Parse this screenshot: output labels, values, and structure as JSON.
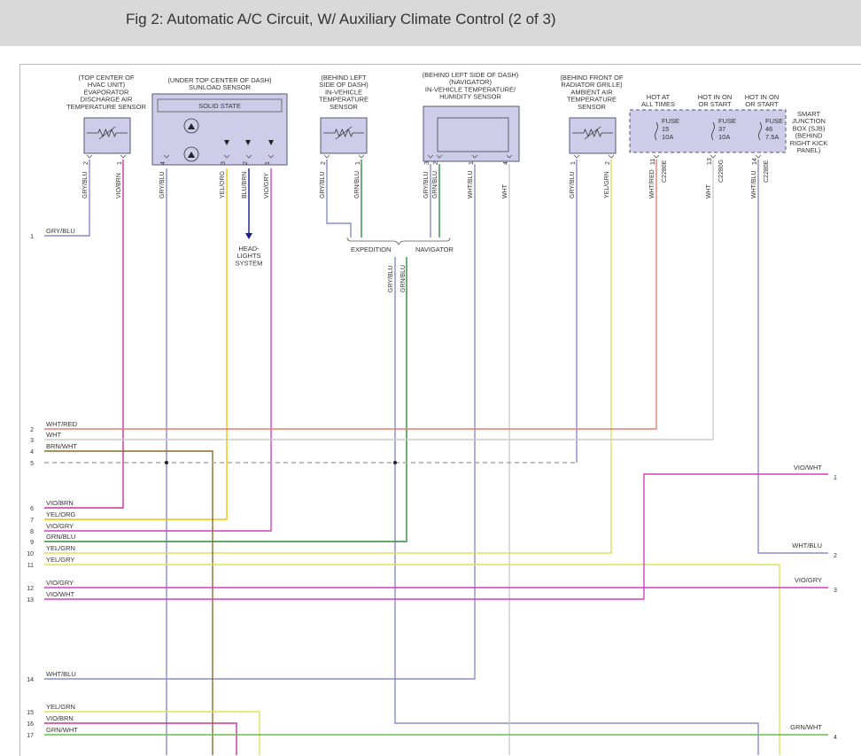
{
  "header": {
    "title": "Fig 2: Automatic A/C Circuit, W/ Auxiliary Climate Control (2 of 3)"
  },
  "colors": {
    "gry_blu": "#8b8bd0",
    "vio_brn": "#cc3399",
    "yel_org": "#f2c200",
    "blu_brn": "#1a1a8c",
    "vio_gry": "#d23fc6",
    "grn_blu": "#2e8b3d",
    "wht_blu": "#8b8bd0",
    "wht": "#cccccc",
    "yel_grn": "#dde15a",
    "wht_red": "#e08070",
    "brn_wht": "#8b6b2a",
    "vio_wht": "#d23fc6",
    "grn_wht": "#6bbf4a",
    "component_fill": "#cdcdea",
    "component_stroke": "#555577"
  },
  "components": {
    "evap": {
      "lines": [
        "(TOP CENTER OF",
        "HVAC UNIT)",
        "EVAPORATOR",
        "DISCHARGE AIR",
        "TEMPERATURE SENSOR"
      ]
    },
    "sunload": {
      "lines": [
        "(UNDER TOP CENTER OF DASH)",
        "SUNLOAD SENSOR"
      ],
      "inner": "SOLID STATE"
    },
    "invehicle": {
      "lines": [
        "(BEHIND LEFT",
        "SIDE OF DASH)",
        "IN-VEHICLE",
        "TEMPERATURE",
        "SENSOR"
      ]
    },
    "humidity": {
      "lines": [
        "(BEHIND LEFT SIDE OF DASH)",
        "(NAVIGATOR)",
        "IN-VEHICLE TEMPERATURE/",
        "HUMIDITY SENSOR"
      ]
    },
    "ambient": {
      "lines": [
        "(BEHIND FRONT OF",
        "RADIATOR GRILLE)",
        "AMBIENT AIR",
        "TEMPERATURE",
        "SENSOR"
      ]
    },
    "sjb": {
      "lines": [
        "SMART",
        "JUNCTION",
        "BOX (SJB)",
        "(BEHIND",
        "RIGHT KICK",
        "PANEL)"
      ],
      "heads": [
        [
          "HOT AT",
          "ALL TIMES"
        ],
        [
          "HOT IN ON",
          "OR START"
        ],
        [
          "HOT IN ON",
          "OR START"
        ]
      ],
      "fuses": [
        [
          "FUSE",
          "15",
          "10A"
        ],
        [
          "FUSE",
          "37",
          "10A"
        ],
        [
          "FUSE",
          "46",
          "7.5A"
        ]
      ]
    },
    "headlights": {
      "lines": [
        "HEAD-",
        "LIGHTS",
        "SYSTEM"
      ]
    }
  },
  "variants": {
    "expedition": "EXPEDITION",
    "navigator": "NAVIGATOR"
  },
  "pins": {
    "evap": [
      "2",
      "1"
    ],
    "sunload": [
      "4",
      "3",
      "2",
      "1"
    ],
    "invehicle": [
      "2",
      "1"
    ],
    "humidity": [
      "3",
      "2",
      "1",
      "4"
    ],
    "ambient": [
      "1",
      "2"
    ],
    "sjb": [
      "11",
      "13",
      "14"
    ]
  },
  "connectors": {
    "c1": "C2280E",
    "c2": "C2280G",
    "c3": "C2280E"
  },
  "wire_labels": {
    "evap": [
      "GRY/BLU",
      "VIO/BRN"
    ],
    "sunload": [
      "GRY/BLU",
      "YEL/ORG",
      "BLU/BRN",
      "VIO/GRY"
    ],
    "invehicle": [
      "GRY/BLU",
      "GRN/BLU"
    ],
    "humidity": [
      "GRY/BLU",
      "GRN/BLU",
      "WHT/BLU",
      "WHT"
    ],
    "ambient": [
      "GRY/BLU",
      "YEL/GRN"
    ],
    "sjb": [
      "WHT/RED",
      "WHT",
      "WHT/BLU"
    ],
    "mid": [
      "GRY/BLU",
      "GRN/BLU"
    ]
  },
  "left_rows": [
    {
      "pin": "1",
      "label": "GRY/BLU"
    },
    {
      "pin": "2",
      "label": "WHT/RED"
    },
    {
      "pin": "3",
      "label": "WHT"
    },
    {
      "pin": "4",
      "label": "BRN/WHT"
    },
    {
      "pin": "5",
      "label": ""
    },
    {
      "pin": "6",
      "label": "VIO/BRN"
    },
    {
      "pin": "7",
      "label": "YEL/ORG"
    },
    {
      "pin": "8",
      "label": "VIO/GRY"
    },
    {
      "pin": "9",
      "label": "GRN/BLU"
    },
    {
      "pin": "10",
      "label": "YEL/GRN"
    },
    {
      "pin": "11",
      "label": "YEL/GRY"
    },
    {
      "pin": "12",
      "label": "VIO/GRY"
    },
    {
      "pin": "13",
      "label": "VIO/WHT"
    },
    {
      "pin": "14",
      "label": "WHT/BLU"
    },
    {
      "pin": "15",
      "label": "YEL/GRN"
    },
    {
      "pin": "16",
      "label": "VIO/BRN"
    },
    {
      "pin": "17",
      "label": "GRN/WHT"
    }
  ],
  "right_rows": [
    {
      "pin": "1",
      "label": "VIO/WHT"
    },
    {
      "pin": "2",
      "label": "WHT/BLU"
    },
    {
      "pin": "3",
      "label": "VIO/GRY"
    },
    {
      "pin": "4",
      "label": "GRN/WHT"
    }
  ]
}
